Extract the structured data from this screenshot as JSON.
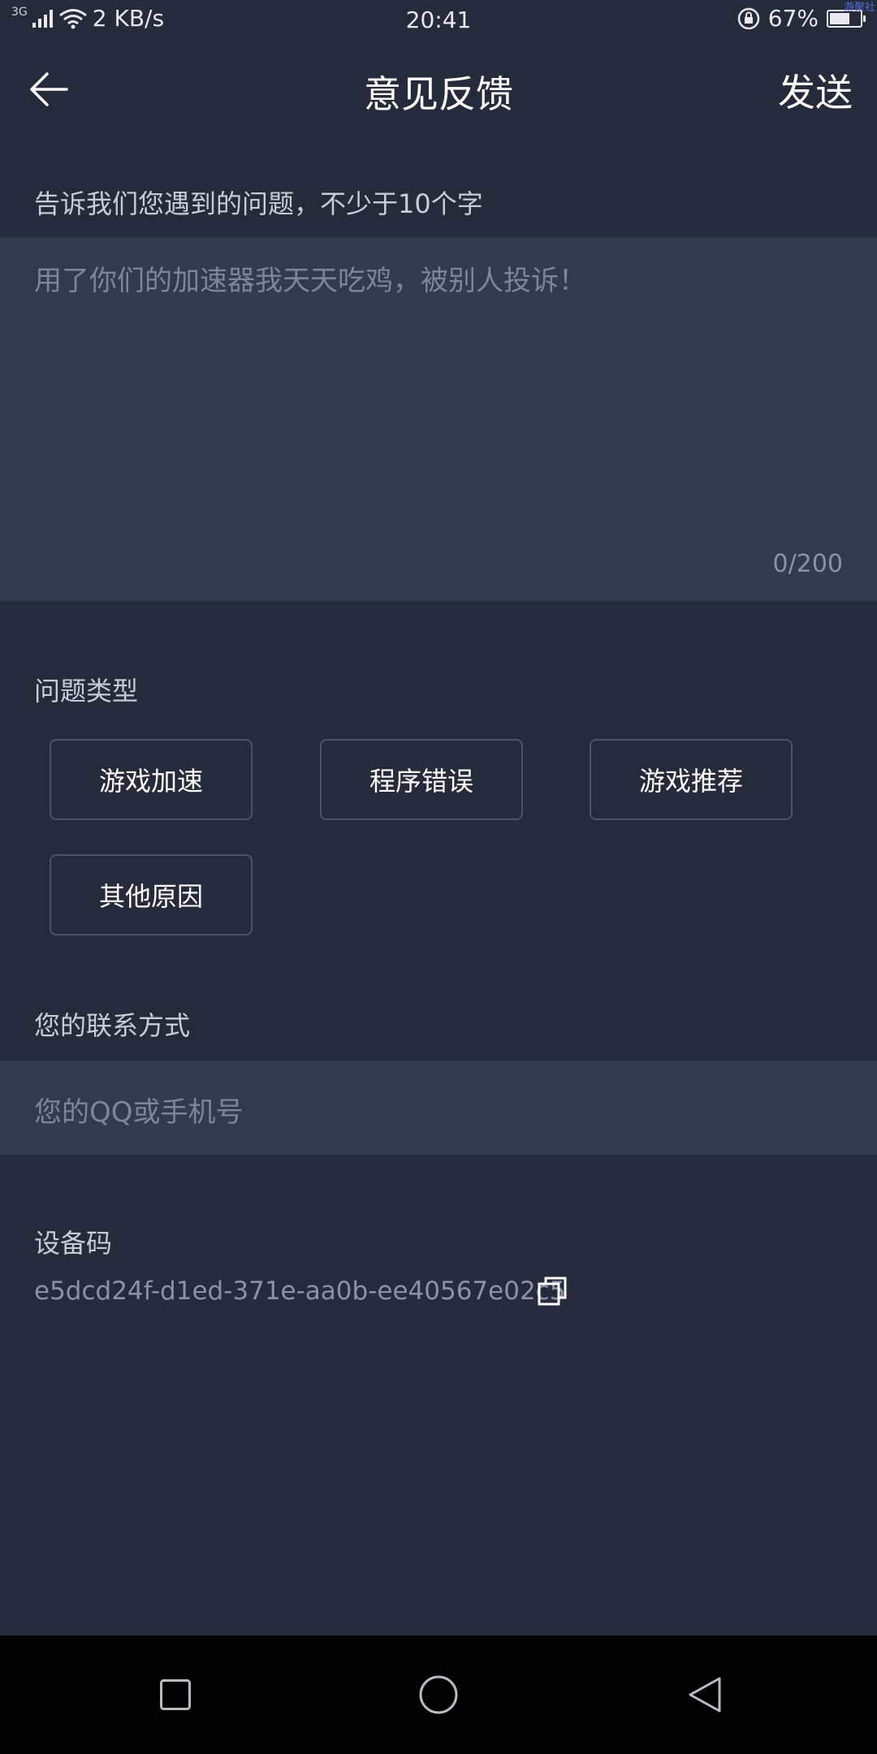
{
  "status_bar": {
    "network": "3G",
    "speed": "2 KB/s",
    "time": "20:41",
    "battery": "67%",
    "battery_level": 0.67,
    "watermark": "游聚社"
  },
  "header": {
    "title": "意见反馈",
    "send_label": "发送"
  },
  "feedback": {
    "label": "告诉我们您遇到的问题，不少于10个字",
    "placeholder": "用了你们的加速器我天天吃鸡，被别人投诉！",
    "counter": "0/200"
  },
  "issue_type": {
    "label": "问题类型",
    "options": [
      "游戏加速",
      "程序错误",
      "游戏推荐",
      "其他原因"
    ]
  },
  "contact": {
    "label": "您的联系方式",
    "placeholder": "您的QQ或手机号"
  },
  "device": {
    "label": "设备码",
    "code": "e5dcd24f-d1ed-371e-aa0b-ee40567e02c5"
  },
  "colors": {
    "background": "#262b3b",
    "input_background": "#313a4e",
    "chip_border": "#4b5368",
    "system_nav": "#000000"
  },
  "icons": {
    "back": "arrow-left-icon",
    "copy": "copy-icon",
    "nav_recent": "square-icon",
    "nav_home": "circle-icon",
    "nav_back": "triangle-icon"
  }
}
